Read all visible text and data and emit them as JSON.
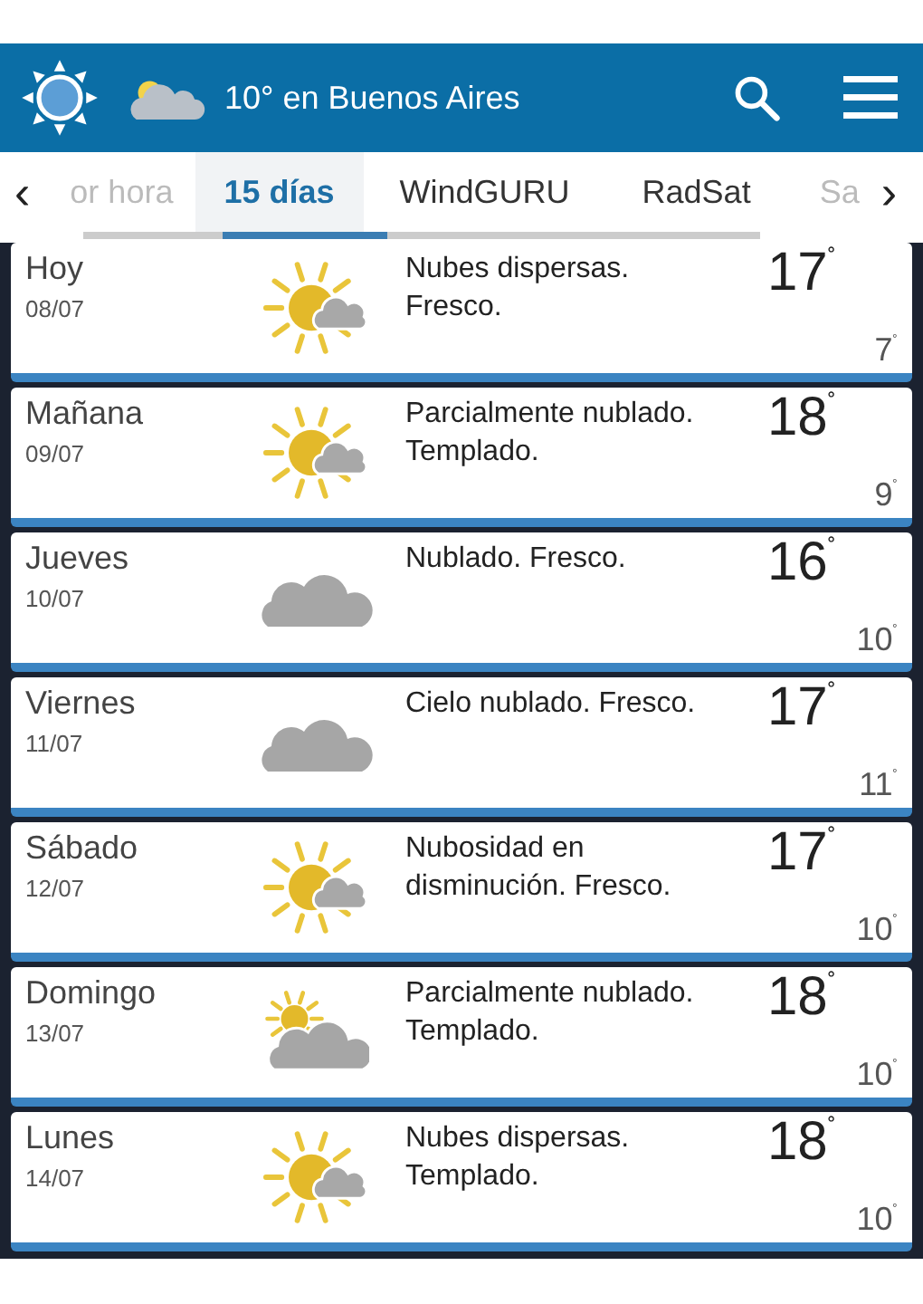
{
  "header": {
    "title": "10° en Buenos Aires"
  },
  "tabs": [
    {
      "label": "‹",
      "kind": "arrow",
      "selected": false
    },
    {
      "label": "or hora",
      "kind": "faded",
      "selected": false
    },
    {
      "label": "15 días",
      "kind": "tab",
      "selected": true
    },
    {
      "label": "WindGURU",
      "kind": "tab",
      "selected": false
    },
    {
      "label": "RadSat",
      "kind": "tab",
      "selected": false
    },
    {
      "label": "Sa",
      "kind": "faded",
      "selected": false
    },
    {
      "label": "›",
      "kind": "arrow",
      "selected": false
    }
  ],
  "days": [
    {
      "day": "Hoy",
      "date": "08/07",
      "kind": "sun_cloud",
      "description": "Nubes dispersas. Fresco.",
      "high": "17$^{˚}$",
      "low": "7$^{˚}$"
    },
    {
      "day": "Mañana",
      "date": "09/07",
      "kind": "sun_cloud",
      "description": "Parcialmente nublado. Templado.",
      "high": "18$^{˚}$",
      "low": "9$^{˚}$"
    },
    {
      "day": "Jueves",
      "date": "10/07",
      "kind": "cloud",
      "description": "Nublado. Fresco.",
      "high": "16$^{˚}$",
      "low": "10$^{˚}$"
    },
    {
      "day": "Viernes",
      "date": "11/07",
      "kind": "cloud",
      "description": "Cielo nublado. Fresco.",
      "high": "17$^{˚}$",
      "low": "11$^{˚}$"
    },
    {
      "day": "Sábado",
      "date": "12/07",
      "kind": "sun_cloud",
      "description": "Nubosidad en disminución. Fresco.",
      "high": "17$^{˚}$",
      "low": "10$^{˚}$"
    },
    {
      "day": "Domingo",
      "date": "13/07",
      "kind": "partly_cloudy",
      "description": "Parcialmente nublado. Templado.",
      "high": "18$^{˚}$",
      "low": "10$^{˚}$"
    },
    {
      "day": "Lunes",
      "date": "14/07",
      "kind": "sun_cloud",
      "description": "Nubes dispersas. Templado.",
      "high": "18$^{˚}$",
      "low": "10$^{˚}$"
    }
  ]
}
